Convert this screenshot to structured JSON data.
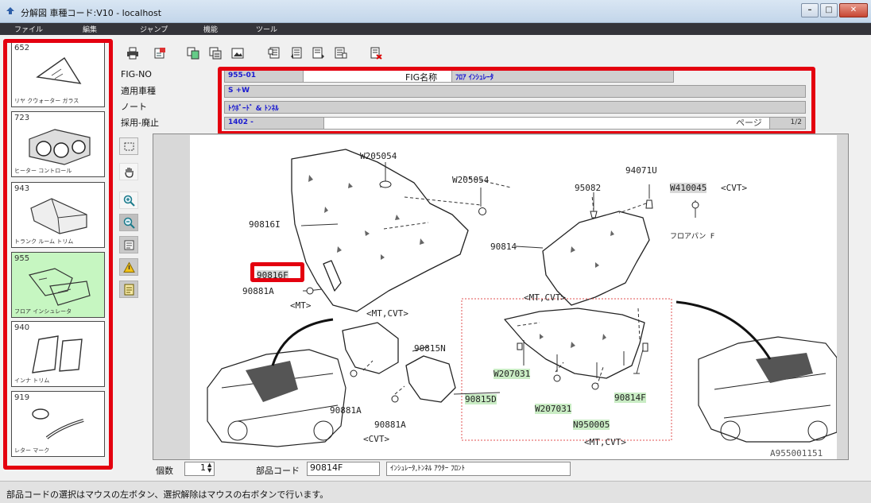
{
  "window": {
    "title": "分解図 車種コード:V10 - localhost",
    "controls": [
      "minimize",
      "maximize",
      "close"
    ]
  },
  "menu": [
    "ファイル",
    "編集",
    "ジャンプ",
    "機能",
    "ツール"
  ],
  "thumbnails": [
    {
      "code": "652",
      "name": "リヤ クウォーター ガラス",
      "selected": false
    },
    {
      "code": "723",
      "name": "ヒーター コントロール",
      "selected": false
    },
    {
      "code": "943",
      "name": "トランク ルーム トリム",
      "selected": false
    },
    {
      "code": "955",
      "name": "フロア インシュレータ",
      "selected": true
    },
    {
      "code": "940",
      "name": "インナ トリム",
      "selected": false
    },
    {
      "code": "919",
      "name": "レター マーク",
      "selected": false
    }
  ],
  "toolbar_icons": [
    "print-icon",
    "print-settings-icon",
    "copy-icon",
    "duplicate-icon",
    "image-icon",
    "page-first-icon",
    "page-prev-icon",
    "page-next-icon",
    "page-last-icon",
    "exit-icon"
  ],
  "header": {
    "fig_no_label": "FIG-NO",
    "fig_no": "955-01",
    "fig_name_label": "FIG名称",
    "fig_name": "ﾌﾛｱ ｲﾝｼｭﾚｰﾀ",
    "vehicle_label": "適用車種",
    "vehicle": "S +W",
    "note_label": "ノート",
    "note": "ﾄｳﾎﾞｰﾄﾞ & ﾄﾝﾈﾙ",
    "adopt_label": "採用-廃止",
    "adopt": "1402 -",
    "page_label": "ページ",
    "page": "1/2"
  },
  "side_tools": [
    "select-rect-icon",
    "pan-hand-icon",
    "zoom-in-icon",
    "zoom-out-icon",
    "fit-page-icon",
    "warning-icon",
    "notes-icon"
  ],
  "diagram": {
    "labels": {
      "w205054_top": "W205054",
      "w205054_mid": "W205054",
      "p94071u": "94071U",
      "p95082": "95082",
      "w410045": "W410045",
      "cvt_tag": "<CVT>",
      "floor_pan": "フロアパン F",
      "p90816i": "90816I",
      "p90814": "90814",
      "p90816f": "90816F",
      "p90881a_top": "90881A",
      "mt_tag": "<MT>",
      "mt_cvt_mid": "<MT,CVT>",
      "mt_cvt_right": "<MT,CVT>",
      "p90815n": "90815N",
      "w207031_a": "W207031",
      "w207031_b": "W207031",
      "p90815d": "90815D",
      "p90814f": "90814F",
      "n950005": "N950005",
      "p90881a_low1": "90881A",
      "p90881a_low2": "90881A",
      "cvt_low": "<CVT>",
      "mt_cvt_low": "<MT,CVT>",
      "fig_code": "A955001151"
    }
  },
  "footer": {
    "qty_label": "個数",
    "qty": "1",
    "part_code_label": "部品コード",
    "part_code": "90814F",
    "part_name": "ｲﾝｼｭﾚｰﾀ,ﾄﾝﾈﾙ ｱｳﾀｰ ﾌﾛﾝﾄ"
  },
  "status": "部品コードの選択はマウスの左ボタン、選択解除はマウスの右ボタンで行います。"
}
